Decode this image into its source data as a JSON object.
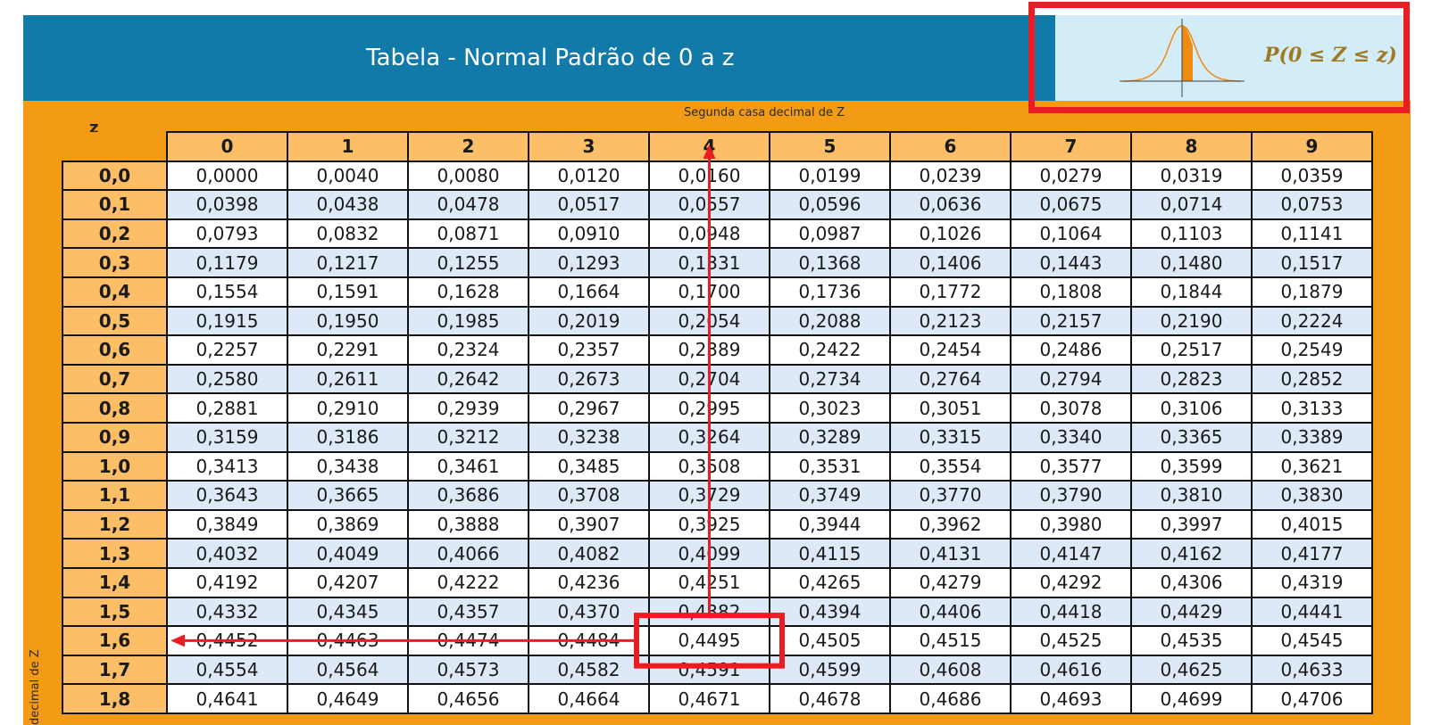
{
  "header": {
    "title": "Tabela - Normal Padrão de 0 a z",
    "formula": "P(0 ≤ Z ≤ z)"
  },
  "table": {
    "row_header": "z",
    "column_caption": "Segunda casa decimal de Z",
    "side_caption": "decimal de Z",
    "columns": [
      "0",
      "1",
      "2",
      "3",
      "4",
      "5",
      "6",
      "7",
      "8",
      "9"
    ],
    "rows": [
      {
        "z": "0,0",
        "values": [
          "0,0000",
          "0,0040",
          "0,0080",
          "0,0120",
          "0,0160",
          "0,0199",
          "0,0239",
          "0,0279",
          "0,0319",
          "0,0359"
        ]
      },
      {
        "z": "0,1",
        "values": [
          "0,0398",
          "0,0438",
          "0,0478",
          "0,0517",
          "0,0557",
          "0,0596",
          "0,0636",
          "0,0675",
          "0,0714",
          "0,0753"
        ]
      },
      {
        "z": "0,2",
        "values": [
          "0,0793",
          "0,0832",
          "0,0871",
          "0,0910",
          "0,0948",
          "0,0987",
          "0,1026",
          "0,1064",
          "0,1103",
          "0,1141"
        ]
      },
      {
        "z": "0,3",
        "values": [
          "0,1179",
          "0,1217",
          "0,1255",
          "0,1293",
          "0,1331",
          "0,1368",
          "0,1406",
          "0,1443",
          "0,1480",
          "0,1517"
        ]
      },
      {
        "z": "0,4",
        "values": [
          "0,1554",
          "0,1591",
          "0,1628",
          "0,1664",
          "0,1700",
          "0,1736",
          "0,1772",
          "0,1808",
          "0,1844",
          "0,1879"
        ]
      },
      {
        "z": "0,5",
        "values": [
          "0,1915",
          "0,1950",
          "0,1985",
          "0,2019",
          "0,2054",
          "0,2088",
          "0,2123",
          "0,2157",
          "0,2190",
          "0,2224"
        ]
      },
      {
        "z": "0,6",
        "values": [
          "0,2257",
          "0,2291",
          "0,2324",
          "0,2357",
          "0,2389",
          "0,2422",
          "0,2454",
          "0,2486",
          "0,2517",
          "0,2549"
        ]
      },
      {
        "z": "0,7",
        "values": [
          "0,2580",
          "0,2611",
          "0,2642",
          "0,2673",
          "0,2704",
          "0,2734",
          "0,2764",
          "0,2794",
          "0,2823",
          "0,2852"
        ]
      },
      {
        "z": "0,8",
        "values": [
          "0,2881",
          "0,2910",
          "0,2939",
          "0,2967",
          "0,2995",
          "0,3023",
          "0,3051",
          "0,3078",
          "0,3106",
          "0,3133"
        ]
      },
      {
        "z": "0,9",
        "values": [
          "0,3159",
          "0,3186",
          "0,3212",
          "0,3238",
          "0,3264",
          "0,3289",
          "0,3315",
          "0,3340",
          "0,3365",
          "0,3389"
        ]
      },
      {
        "z": "1,0",
        "values": [
          "0,3413",
          "0,3438",
          "0,3461",
          "0,3485",
          "0,3508",
          "0,3531",
          "0,3554",
          "0,3577",
          "0,3599",
          "0,3621"
        ]
      },
      {
        "z": "1,1",
        "values": [
          "0,3643",
          "0,3665",
          "0,3686",
          "0,3708",
          "0,3729",
          "0,3749",
          "0,3770",
          "0,3790",
          "0,3810",
          "0,3830"
        ]
      },
      {
        "z": "1,2",
        "values": [
          "0,3849",
          "0,3869",
          "0,3888",
          "0,3907",
          "0,3925",
          "0,3944",
          "0,3962",
          "0,3980",
          "0,3997",
          "0,4015"
        ]
      },
      {
        "z": "1,3",
        "values": [
          "0,4032",
          "0,4049",
          "0,4066",
          "0,4082",
          "0,4099",
          "0,4115",
          "0,4131",
          "0,4147",
          "0,4162",
          "0,4177"
        ]
      },
      {
        "z": "1,4",
        "values": [
          "0,4192",
          "0,4207",
          "0,4222",
          "0,4236",
          "0,4251",
          "0,4265",
          "0,4279",
          "0,4292",
          "0,4306",
          "0,4319"
        ]
      },
      {
        "z": "1,5",
        "values": [
          "0,4332",
          "0,4345",
          "0,4357",
          "0,4370",
          "0,4382",
          "0,4394",
          "0,4406",
          "0,4418",
          "0,4429",
          "0,4441"
        ]
      },
      {
        "z": "1,6",
        "values": [
          "0,4452",
          "0,4463",
          "0,4474",
          "0,4484",
          "0,4495",
          "0,4505",
          "0,4515",
          "0,4525",
          "0,4535",
          "0,4545"
        ]
      },
      {
        "z": "1,7",
        "values": [
          "0,4554",
          "0,4564",
          "0,4573",
          "0,4582",
          "0,4591",
          "0,4599",
          "0,4608",
          "0,4616",
          "0,4625",
          "0,4633"
        ]
      },
      {
        "z": "1,8",
        "values": [
          "0,4641",
          "0,4649",
          "0,4656",
          "0,4664",
          "0,4671",
          "0,4678",
          "0,4686",
          "0,4693",
          "0,4699",
          "0,4706"
        ]
      }
    ]
  },
  "annotation": {
    "highlight_row": "1,6",
    "highlight_column": "4",
    "highlight_value": "0,4495",
    "highlight_color": "#ea1c24"
  },
  "colors": {
    "header_bar": "#127aa9",
    "formula_panel": "#d2ecf8",
    "frame": "#f39b14",
    "header_cell": "#fcbe66",
    "stripe": "#dde9f7"
  }
}
